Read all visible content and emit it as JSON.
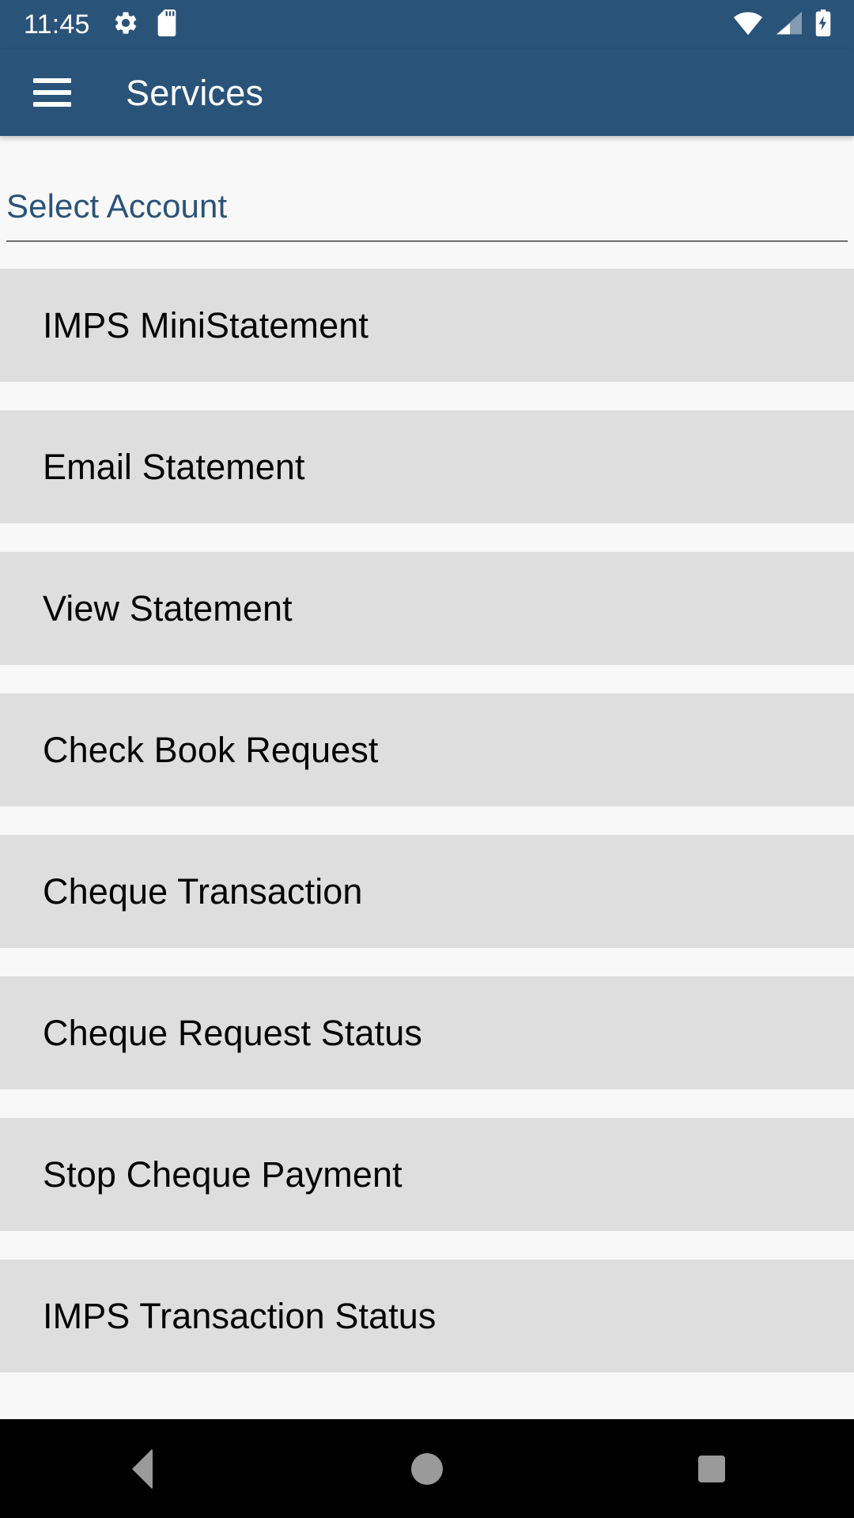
{
  "status_bar": {
    "time": "11:45",
    "left_icons": [
      "gear-icon",
      "sd-card-icon"
    ],
    "right_icons": [
      "wifi-icon",
      "cellular-signal-icon",
      "battery-charging-icon"
    ],
    "background_color": "#2a5379"
  },
  "app_bar": {
    "menu_icon": "hamburger-menu-icon",
    "title": "Services",
    "background_color": "#2a5379",
    "text_color": "#ffffff"
  },
  "form": {
    "select_account": {
      "label": "Select Account",
      "value": "",
      "placeholder": "Select Account",
      "label_color": "#2a5379"
    }
  },
  "services": {
    "item_background_color": "#dedede",
    "items": [
      {
        "label": "IMPS MiniStatement"
      },
      {
        "label": "Email Statement"
      },
      {
        "label": "View Statement"
      },
      {
        "label": "Check Book Request"
      },
      {
        "label": "Cheque Transaction"
      },
      {
        "label": "Cheque Request Status"
      },
      {
        "label": "Stop Cheque Payment"
      },
      {
        "label": "IMPS Transaction Status"
      }
    ]
  },
  "navigation_bar": {
    "background_color": "#000000",
    "buttons": [
      {
        "name": "back-button",
        "icon": "triangle-left-icon"
      },
      {
        "name": "home-button",
        "icon": "circle-icon"
      },
      {
        "name": "recents-button",
        "icon": "square-icon"
      }
    ]
  }
}
